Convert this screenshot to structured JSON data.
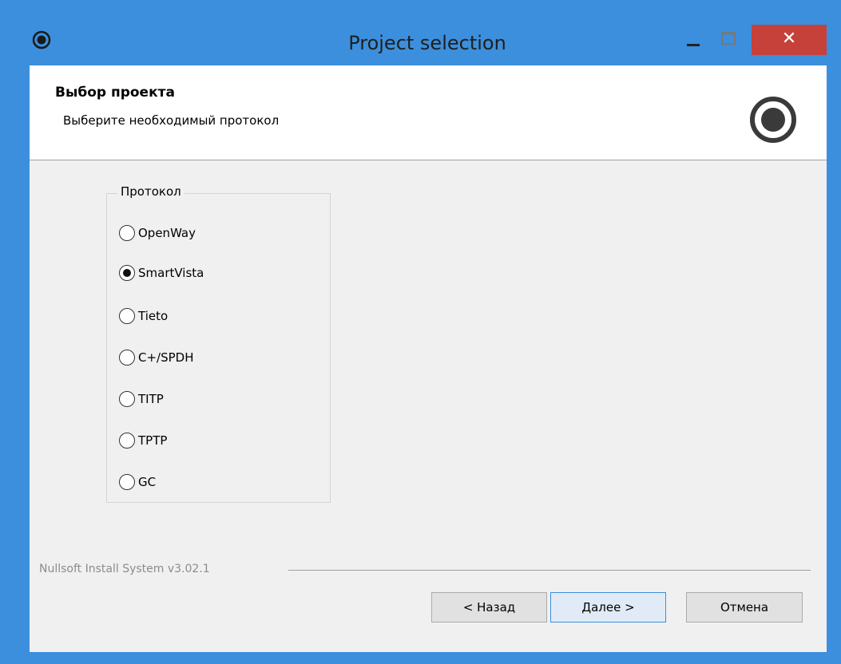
{
  "window": {
    "title": "Project selection",
    "close_glyph": "✕",
    "app_icon": "radio-target-icon",
    "colors": {
      "frame": "#3c8fdc",
      "close_button": "#c6413a",
      "client_background": "#f0f0f0"
    }
  },
  "header": {
    "title": "Выбор проекта",
    "subtitle": "Выберите необходимый протокол",
    "icon": "radio-target-icon"
  },
  "protocol_group": {
    "legend": "Протокол",
    "selected": "SmartVista",
    "options": [
      {
        "label": "OpenWay",
        "checked": false
      },
      {
        "label": "SmartVista",
        "checked": true
      },
      {
        "label": "Tieto",
        "checked": false
      },
      {
        "label": "C+/SPDH",
        "checked": false
      },
      {
        "label": "TITP",
        "checked": false
      },
      {
        "label": "TPTP",
        "checked": false
      },
      {
        "label": "GC",
        "checked": false
      }
    ]
  },
  "footer": {
    "branding": "Nullsoft Install System v3.02.1",
    "buttons": {
      "back": "< Назад",
      "next": "Далее >",
      "cancel": "Отмена"
    }
  }
}
